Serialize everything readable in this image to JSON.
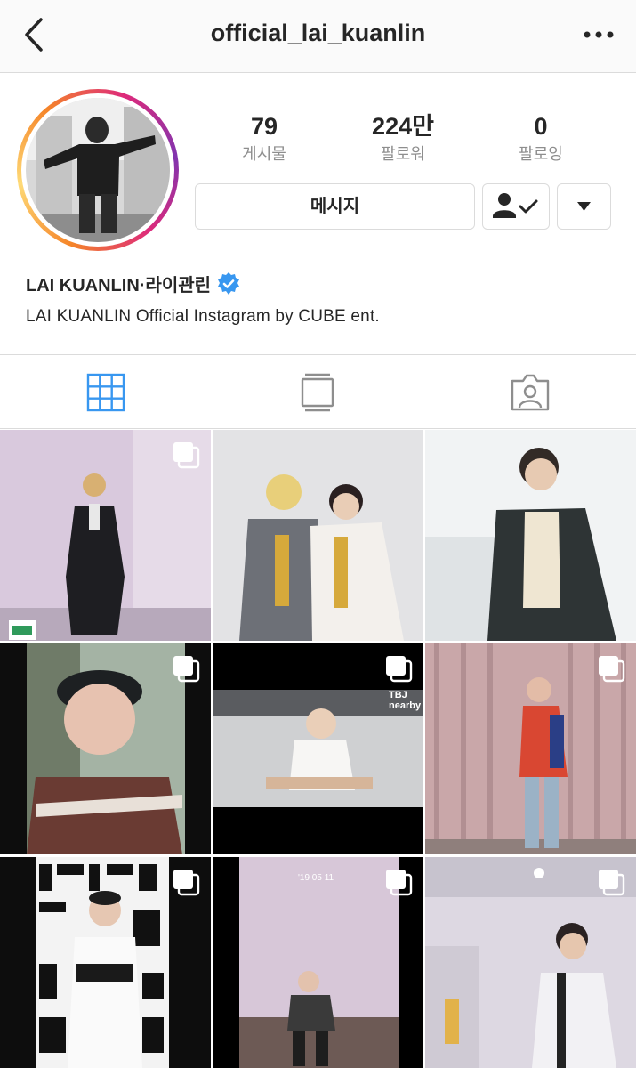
{
  "header": {
    "username": "official_lai_kuanlin",
    "back_icon": "chevron-left-icon",
    "more_icon": "more-horizontal-icon"
  },
  "profile": {
    "stats": [
      {
        "value": "79",
        "label": "게시물"
      },
      {
        "value": "224만",
        "label": "팔로워"
      },
      {
        "value": "0",
        "label": "팔로잉"
      }
    ],
    "message_button": "메시지",
    "display_name": "LAI KUANLIN·라이관린",
    "bio": "LAI KUANLIN Official Instagram by CUBE ent."
  },
  "tabs": [
    "grid-icon",
    "igtv-icon",
    "tagged-icon"
  ],
  "posts": {
    "post5_overlay": "TBJ nearby",
    "post8_overlay": "'19 05 11"
  },
  "colors": {
    "accent": "#3897f0",
    "verified": "#3897f0",
    "border": "#dbdbdb",
    "secondary_text": "#8e8e8e"
  }
}
